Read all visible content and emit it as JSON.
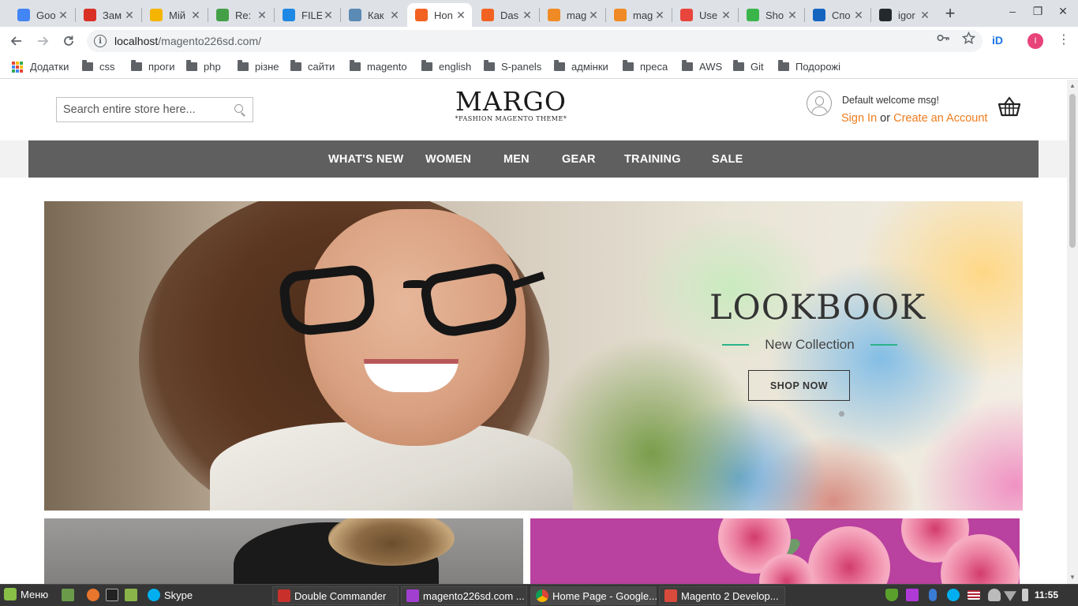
{
  "browser": {
    "tabs": [
      {
        "title": "Goo",
        "favicon": "google-g",
        "color": "#4285f4"
      },
      {
        "title": "Зам",
        "favicon": "gmail-m",
        "color": "#d93025"
      },
      {
        "title": "Мій",
        "favicon": "google-drive",
        "color": "#f4b400"
      },
      {
        "title": "Re:",
        "favicon": "mail-envelope",
        "color": "#43a047"
      },
      {
        "title": "FILE",
        "favicon": "file-doc",
        "color": "#1e88e5"
      },
      {
        "title": "Как",
        "favicon": "habr-h",
        "color": "#5b8ab5"
      },
      {
        "title": "Hon",
        "favicon": "magento",
        "color": "#f26322",
        "active": true
      },
      {
        "title": "Das",
        "favicon": "magento",
        "color": "#f26322"
      },
      {
        "title": "mag",
        "favicon": "magento-box",
        "color": "#f08a24"
      },
      {
        "title": "mag",
        "favicon": "magento-box",
        "color": "#f08a24"
      },
      {
        "title": "Use",
        "favicon": "asterisk-red",
        "color": "#e8453c"
      },
      {
        "title": "Sho",
        "favicon": "green-b",
        "color": "#3ab54a"
      },
      {
        "title": "Спо",
        "favicon": "de-dict",
        "color": "#1565c0"
      },
      {
        "title": "igor",
        "favicon": "github",
        "color": "#24292e"
      }
    ],
    "close_glyph": "✕",
    "new_tab_glyph": "+",
    "window_controls": [
      "–",
      "❐",
      "✕"
    ],
    "url_host": "localhost",
    "url_path": "/magento226sd.com/",
    "extension_label": "iD",
    "profile_initial": "I",
    "bookmarks": [
      {
        "label": "Додатки",
        "icon": "apps-grid-icon"
      },
      {
        "label": "css",
        "icon": "folder-icon"
      },
      {
        "label": "проги",
        "icon": "folder-icon"
      },
      {
        "label": "php",
        "icon": "folder-icon"
      },
      {
        "label": "різне",
        "icon": "folder-icon"
      },
      {
        "label": "сайти",
        "icon": "folder-icon"
      },
      {
        "label": "magento",
        "icon": "folder-icon"
      },
      {
        "label": "english",
        "icon": "folder-icon"
      },
      {
        "label": "S-panels",
        "icon": "folder-icon"
      },
      {
        "label": "адмінки",
        "icon": "folder-icon"
      },
      {
        "label": "преса",
        "icon": "folder-icon"
      },
      {
        "label": "AWS",
        "icon": "folder-icon"
      },
      {
        "label": "Git",
        "icon": "folder-icon"
      },
      {
        "label": "Подорожі",
        "icon": "folder-icon"
      }
    ]
  },
  "store": {
    "search_placeholder": "Search entire store here...",
    "logo_text": "MARGO",
    "logo_tagline": "*FASHION MAGENTO THEME*",
    "welcome_msg": "Default welcome msg!",
    "sign_in": "Sign In",
    "or_text": " or ",
    "create_account": "Create an Account",
    "nav": [
      "WHAT'S NEW",
      "WOMEN",
      "MEN",
      "GEAR",
      "TRAINING",
      "SALE"
    ],
    "hero": {
      "title": "LOOKBOOK",
      "subtitle": "New Collection",
      "cta": "SHOP NOW",
      "accent_color": "#2bb38a"
    },
    "link_color": "#ee7c1d",
    "nav_bg": "#5f5f5f"
  },
  "taskbar": {
    "menu_label": "Меню",
    "launchers": [
      "files-icon",
      "firefox-icon",
      "terminal-icon",
      "folder-icon"
    ],
    "pinned_app": "Skype",
    "windows": [
      {
        "label": "Double Commander",
        "icon": "double-commander-icon"
      },
      {
        "label": "magento226sd.com ...",
        "icon": "phpstorm-icon"
      },
      {
        "label": "Home Page - Google...",
        "icon": "chrome-icon",
        "active": true
      },
      {
        "label": "Magento 2 Develop...",
        "icon": "document-icon"
      }
    ],
    "clock": "11:55"
  }
}
